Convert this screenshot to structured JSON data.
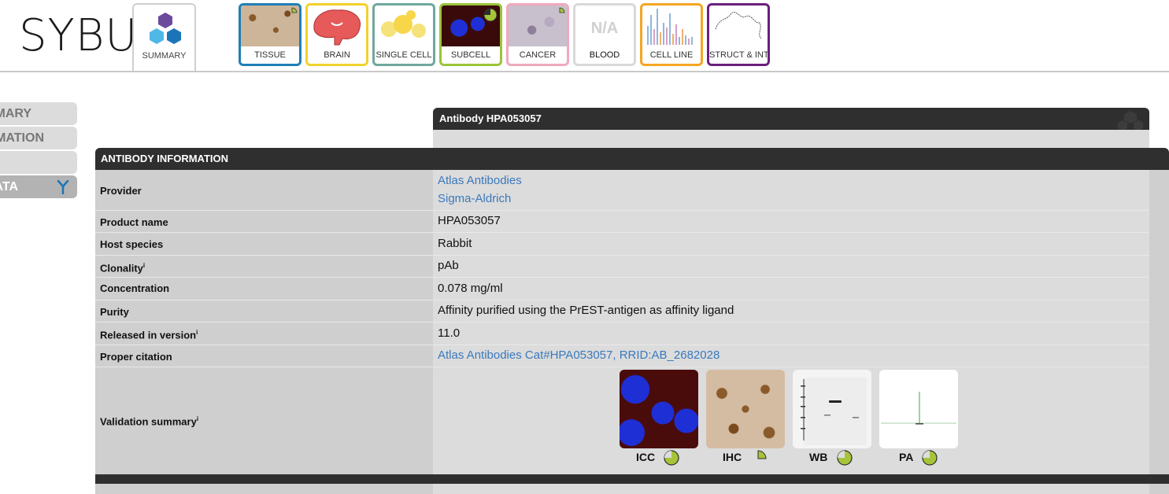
{
  "header": {
    "logo_text": "SYBU",
    "summary_tab": "SUMMARY",
    "tabs": [
      {
        "label": "TISSUE",
        "border": "#1f7fb6"
      },
      {
        "label": "BRAIN",
        "border": "#f2d22e"
      },
      {
        "label": "SINGLE CELL",
        "border": "#6fa89e"
      },
      {
        "label": "SUBCELL",
        "border": "#9bc43a"
      },
      {
        "label": "CANCER",
        "border": "#f0a8bd"
      },
      {
        "label": "BLOOD",
        "border": "#d9d9d9",
        "thumb_text": "N/A"
      },
      {
        "label": "CELL LINE",
        "border": "#f5a623"
      },
      {
        "label": "STRUCT & INT",
        "border": "#6b1f7c"
      }
    ]
  },
  "sidemenu": {
    "items": [
      "MARY",
      "MATION",
      "",
      "ATA"
    ]
  },
  "antibody_box": {
    "title": "Antibody HPA053057"
  },
  "info": {
    "heading": "ANTIBODY INFORMATION",
    "provider_label": "Provider",
    "providers": [
      "Atlas Antibodies",
      "Sigma-Aldrich"
    ],
    "product_name_label": "Product name",
    "product_name": "HPA053057",
    "host_species_label": "Host species",
    "host_species": "Rabbit",
    "clonality_label": "Clonality",
    "clonality": "pAb",
    "concentration_label": "Concentration",
    "concentration": "0.078 mg/ml",
    "purity_label": "Purity",
    "purity": "Affinity purified using the PrEST-antigen as affinity ligand",
    "released_label": "Released in version",
    "released": "11.0",
    "citation_label": "Proper citation",
    "citation": "Atlas Antibodies Cat#HPA053057, RRID:AB_2682028",
    "validation_label": "Validation summary",
    "info_marker": "i",
    "validations": [
      {
        "label": "ICC",
        "level": 0.75
      },
      {
        "label": "IHC",
        "level": 0.25
      },
      {
        "label": "WB",
        "level": 0.75
      },
      {
        "label": "PA",
        "level": 0.75
      }
    ]
  },
  "colors": {
    "dark_bar": "#2f2f2f",
    "link": "#3a79bd",
    "pie_green": "#a6c439"
  }
}
